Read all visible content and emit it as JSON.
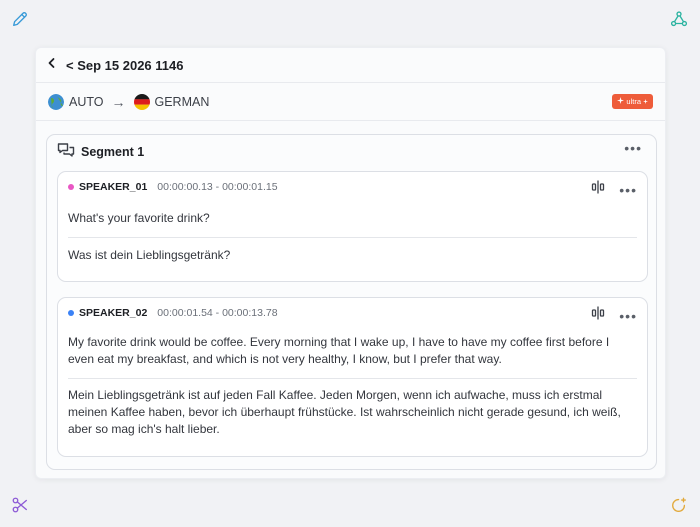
{
  "header": {
    "title": "< Sep 15 2026 1146"
  },
  "languages": {
    "source": "AUTO",
    "target": "GERMAN",
    "arrow": "→"
  },
  "badge": {
    "label": "ultra"
  },
  "segment": {
    "title": "Segment 1",
    "entries": [
      {
        "speaker": "SPEAKER_01",
        "time": "00:00:00.13 - 00:00:01.15",
        "dot_color": "#e957c4",
        "original": "What's your favorite drink?",
        "translation": "Was ist dein Lieblingsgetränk?"
      },
      {
        "speaker": "SPEAKER_02",
        "time": "00:00:01.54 - 00:00:13.78",
        "dot_color": "#3b82f6",
        "original": "My favorite drink would be coffee. Every morning that I wake up, I have to have my coffee first before I even eat my breakfast, and which is not very healthy, I know, but I prefer that way.",
        "translation": "Mein Lieblingsgetränk ist auf jeden Fall Kaffee. Jeden Morgen, wenn ich aufwache, muss ich erstmal meinen Kaffee haben, bevor ich überhaupt frühstücke. Ist wahrscheinlich nicht gerade gesund, ich weiß, aber so mag ich's halt lieber."
      }
    ]
  },
  "icons": {
    "top_left": "pencil-icon",
    "top_right": "share-nodes-icon",
    "bottom_left": "scissors-icon",
    "bottom_right": "ai-sparkle-icon"
  },
  "colors": {
    "accent_blue": "#3a9bd8",
    "teal": "#2bb3a0",
    "purple": "#8e5bd6",
    "gold": "#e2a93b",
    "badge": "#ee5c3a"
  }
}
